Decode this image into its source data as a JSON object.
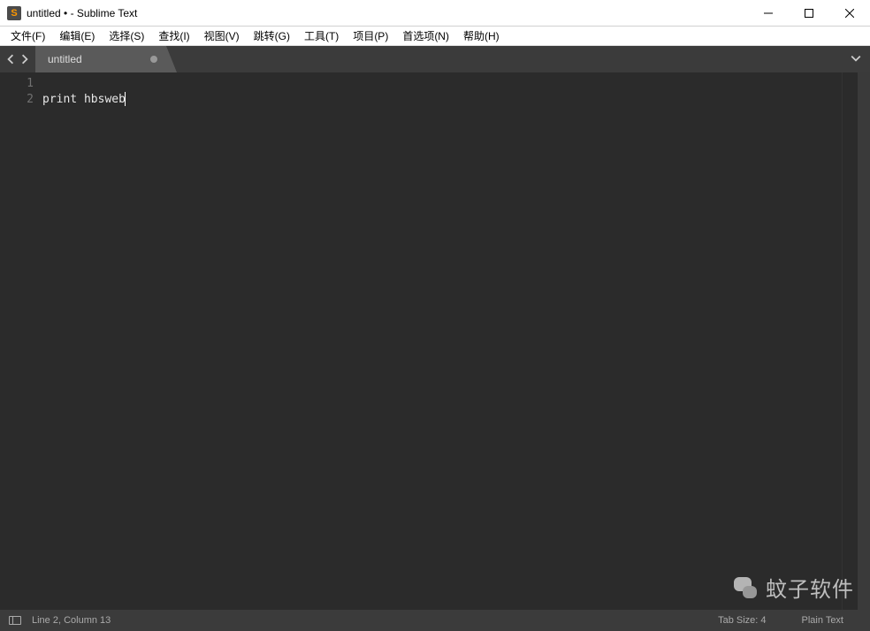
{
  "titlebar": {
    "title": "untitled • - Sublime Text"
  },
  "menubar": {
    "items": [
      {
        "label": "文件(F)",
        "u": "F"
      },
      {
        "label": "编辑(E)",
        "u": "E"
      },
      {
        "label": "选择(S)",
        "u": "S"
      },
      {
        "label": "查找(I)",
        "u": "I"
      },
      {
        "label": "视图(V)",
        "u": "V"
      },
      {
        "label": "跳转(G)",
        "u": "G"
      },
      {
        "label": "工具(T)",
        "u": "T"
      },
      {
        "label": "项目(P)",
        "u": "P"
      },
      {
        "label": "首选项(N)",
        "u": "N"
      },
      {
        "label": "帮助(H)",
        "u": "H"
      }
    ]
  },
  "tabs": {
    "active": {
      "label": "untitled",
      "dirty": true
    }
  },
  "editor": {
    "lines": [
      "",
      "print hbsweb"
    ],
    "line_numbers": [
      "1",
      "2"
    ],
    "cursor_line": 2
  },
  "statusbar": {
    "position": "Line 2, Column 13",
    "tab_size": "Tab Size: 4",
    "syntax": "Plain Text"
  },
  "watermark": {
    "text": "蚊子软件"
  }
}
